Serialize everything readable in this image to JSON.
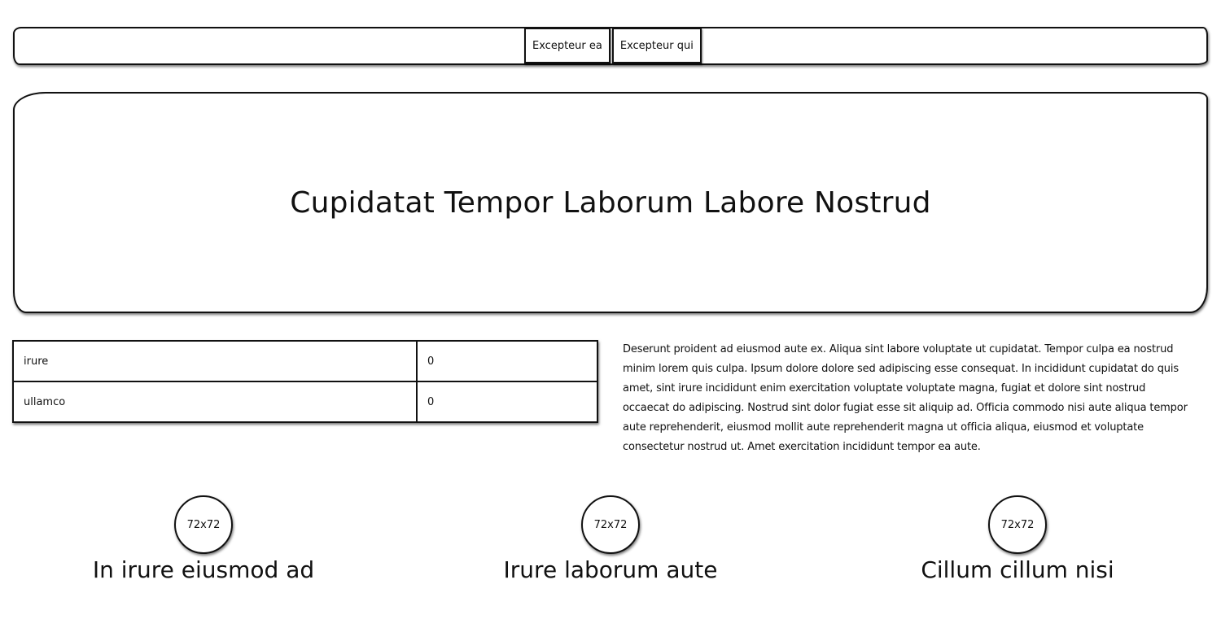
{
  "nav": {
    "buttons": [
      {
        "label": "Excepteur ea"
      },
      {
        "label": "Excepteur qui"
      }
    ]
  },
  "hero": {
    "title": "Cupidatat Tempor Laborum Labore Nostrud"
  },
  "table": {
    "rows": [
      {
        "label": "irure",
        "value": "0"
      },
      {
        "label": "ullamco",
        "value": "0"
      }
    ]
  },
  "paragraph": "Deserunt proident ad eiusmod aute ex. Aliqua sint labore voluptate ut cupidatat. Tempor culpa ea nostrud minim lorem quis culpa. Ipsum dolore dolore sed adipiscing esse consequat. In incididunt cupidatat do quis amet, sint irure incididunt enim exercitation voluptate voluptate magna, fugiat et dolore sint nostrud occaecat do adipiscing. Nostrud sint dolor fugiat esse sit aliquip ad. Officia commodo nisi aute aliqua tempor aute reprehenderit, eiusmod mollit aute reprehenderit magna ut officia aliqua, eiusmod et voluptate consectetur nostrud ut. Amet exercitation incididunt tempor ea aute.",
  "features": [
    {
      "image_label": "72x72",
      "title": "In irure eiusmod ad"
    },
    {
      "image_label": "72x72",
      "title": "Irure laborum aute"
    },
    {
      "image_label": "72x72",
      "title": "Cillum cillum nisi"
    }
  ]
}
